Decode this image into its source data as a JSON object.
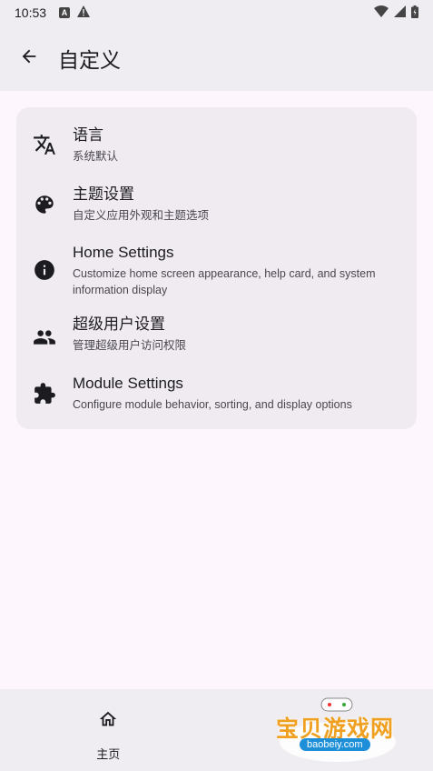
{
  "status_bar": {
    "time": "10:53"
  },
  "header": {
    "title": "自定义"
  },
  "settings": [
    {
      "icon": "translate-icon",
      "title": "语言",
      "subtitle": "系统默认"
    },
    {
      "icon": "palette-icon",
      "title": "主题设置",
      "subtitle": "自定义应用外观和主题选项"
    },
    {
      "icon": "info-icon",
      "title": "Home Settings",
      "subtitle": "Customize home screen appearance, help card, and system information display"
    },
    {
      "icon": "people-icon",
      "title": "超级用户设置",
      "subtitle": "管理超级用户访问权限"
    },
    {
      "icon": "extension-icon",
      "title": "Module Settings",
      "subtitle": "Configure module behavior, sorting, and display options"
    }
  ],
  "bottom_nav": [
    {
      "icon": "home-icon",
      "label": "主页"
    }
  ],
  "watermark": {
    "text": "宝贝游戏网",
    "url": "baobeiy.com"
  }
}
